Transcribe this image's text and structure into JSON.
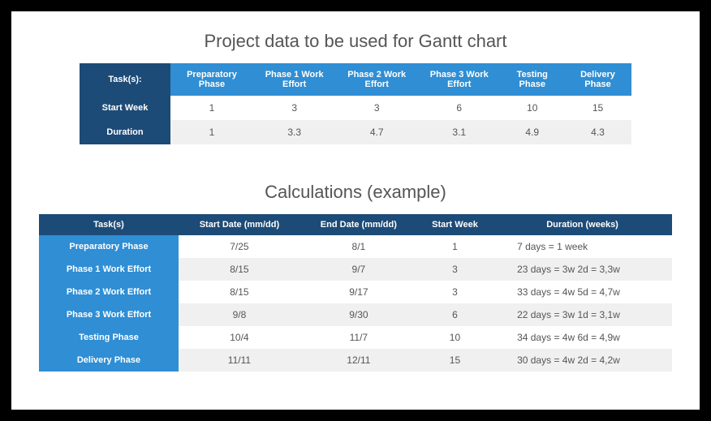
{
  "section1": {
    "title": "Project data to be used for Gantt chart",
    "corner": "Task(s):",
    "columns": [
      "Preparatory Phase",
      "Phase 1 Work Effort",
      "Phase 2 Work Effort",
      "Phase 3 Work Effort",
      "Testing Phase",
      "Delivery Phase"
    ],
    "rows": [
      {
        "label": "Start Week",
        "values": [
          "1",
          "3",
          "3",
          "6",
          "10",
          "15"
        ]
      },
      {
        "label": "Duration",
        "values": [
          "1",
          "3.3",
          "4.7",
          "3.1",
          "4.9",
          "4.3"
        ]
      }
    ]
  },
  "section2": {
    "title": "Calculations (example)",
    "headers": [
      "Task(s)",
      "Start Date (mm/dd)",
      "End Date (mm/dd)",
      "Start Week",
      "Duration (weeks)"
    ],
    "rows": [
      {
        "task": "Preparatory Phase",
        "start": "7/25",
        "end": "8/1",
        "week": "1",
        "duration": "7 days = 1 week"
      },
      {
        "task": "Phase 1 Work Effort",
        "start": "8/15",
        "end": "9/7",
        "week": "3",
        "duration": "23 days = 3w 2d = 3,3w"
      },
      {
        "task": "Phase 2 Work Effort",
        "start": "8/15",
        "end": "9/17",
        "week": "3",
        "duration": "33 days = 4w 5d = 4,7w"
      },
      {
        "task": "Phase 3 Work Effort",
        "start": "9/8",
        "end": "9/30",
        "week": "6",
        "duration": "22 days = 3w 1d = 3,1w"
      },
      {
        "task": "Testing Phase",
        "start": "10/4",
        "end": "11/7",
        "week": "10",
        "duration": "34 days = 4w  6d = 4,9w"
      },
      {
        "task": "Delivery Phase",
        "start": "11/11",
        "end": "12/11",
        "week": "15",
        "duration": "30 days = 4w 2d = 4,2w"
      }
    ]
  },
  "chart_data": {
    "type": "table",
    "title": "Project data to be used for Gantt chart",
    "categories": [
      "Preparatory Phase",
      "Phase 1 Work Effort",
      "Phase 2 Work Effort",
      "Phase 3 Work Effort",
      "Testing Phase",
      "Delivery Phase"
    ],
    "series": [
      {
        "name": "Start Week",
        "values": [
          1,
          3,
          3,
          6,
          10,
          15
        ]
      },
      {
        "name": "Duration",
        "values": [
          1,
          3.3,
          4.7,
          3.1,
          4.9,
          4.3
        ]
      }
    ]
  }
}
